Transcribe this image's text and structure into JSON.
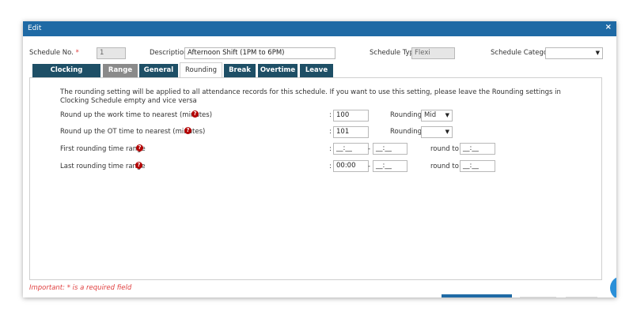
{
  "dialog": {
    "title": "Edit",
    "close_icon": "×"
  },
  "header": {
    "schedule_no_label": "Schedule No.",
    "required_mark": "*",
    "schedule_no_value": "1",
    "description_label": "Description",
    "description_value": "Afternoon Shift (1PM to 6PM)",
    "schedule_type_label": "Schedule Type",
    "schedule_type_value": "Flexi",
    "schedule_category_label": "Schedule Category",
    "schedule_category_value": ""
  },
  "tabs": [
    {
      "label": "Clocking Schedule"
    },
    {
      "label": "Range"
    },
    {
      "label": "General"
    },
    {
      "label": "Rounding"
    },
    {
      "label": "Break"
    },
    {
      "label": "Overtime"
    },
    {
      "label": "Leave"
    }
  ],
  "rounding": {
    "note": "The rounding setting will be applied to all attendance records for this schedule. If you want to use this setting, please leave the Rounding settings in Clocking Schedule empty and vice versa",
    "help_glyph": "?",
    "colon": ":",
    "dash": "-",
    "rows": [
      {
        "label": "Round up the work time to nearest (minutes)",
        "value": "100",
        "rounding_label": "Rounding",
        "rounding_value": "Mid"
      },
      {
        "label": "Round up the OT time to nearest (minutes)",
        "value": "101",
        "rounding_label": "Rounding",
        "rounding_value": ""
      },
      {
        "label": "First rounding time range",
        "from": "__:__",
        "to": "__:__",
        "round_to_label": "round to",
        "round_to": "__:__"
      },
      {
        "label": "Last rounding time range",
        "from": "00:00",
        "to": "__:__",
        "round_to_label": "round to",
        "round_to": "__:__"
      }
    ]
  },
  "footer": {
    "important": "Important: * is a required field"
  },
  "colors": {
    "accent": "#1f6aa5",
    "tab_dark": "#1e4f66",
    "tab_gray": "#8a8a8a",
    "required": "#e04040",
    "help": "#b30000"
  }
}
